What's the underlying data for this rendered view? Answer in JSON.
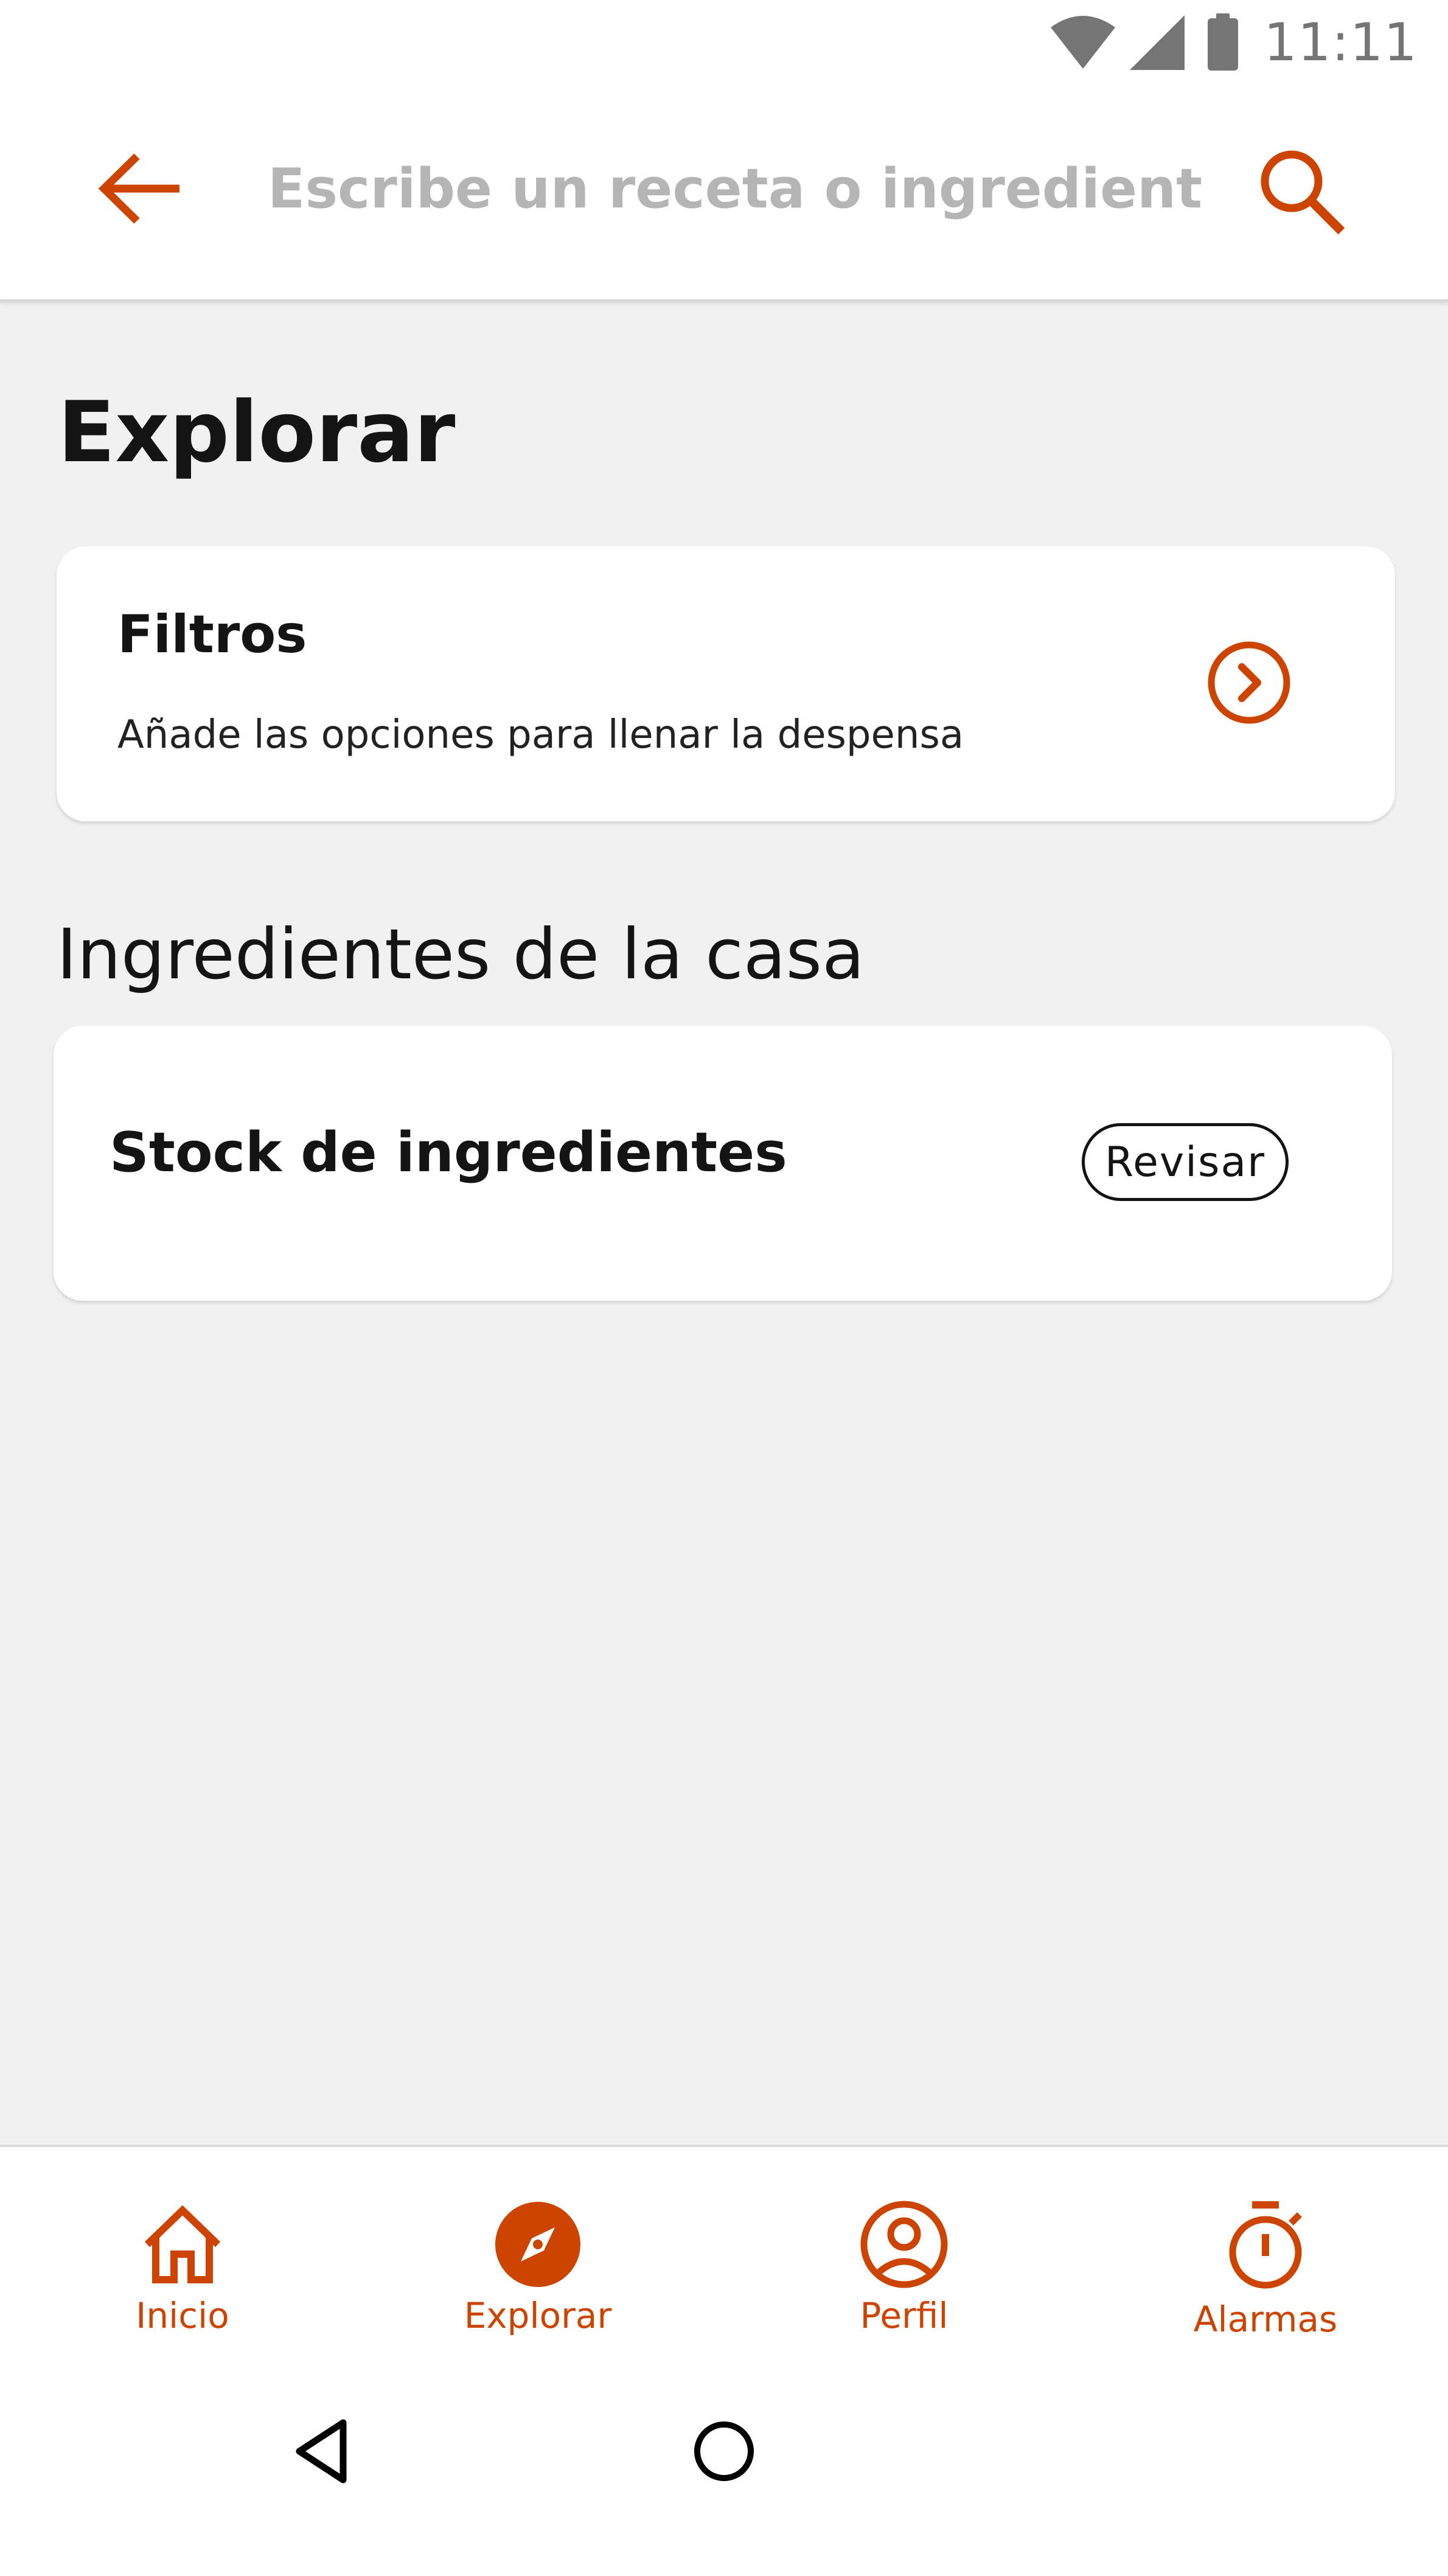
{
  "status_bar": {
    "time": "11:11",
    "icons": [
      "wifi-icon",
      "signal-icon",
      "battery-icon"
    ]
  },
  "search": {
    "placeholder": "Escribe un receta o ingrediente",
    "value": "",
    "icons": [
      "back-arrow-icon",
      "search-icon"
    ]
  },
  "main": {
    "title": "Explorar",
    "filters_card": {
      "title": "Filtros",
      "subtitle": "Añade las opciones para llenar la despensa",
      "icon": "chevron-right-circle-icon"
    },
    "section_title": "Ingredientes de la casa",
    "stock_card": {
      "title": "Stock de ingredientes",
      "button_label": "Revisar"
    }
  },
  "bottom_nav": {
    "items": [
      {
        "label": "Inicio",
        "icon": "home-icon"
      },
      {
        "label": "Explorar",
        "icon": "compass-icon",
        "active": true
      },
      {
        "label": "Perfil",
        "icon": "profile-icon"
      },
      {
        "label": "Alarmas",
        "icon": "timer-icon"
      }
    ]
  },
  "system_nav": {
    "icons": [
      "system-back-icon",
      "system-home-icon"
    ]
  },
  "colors": {
    "accent": "#CC4400",
    "background": "#F1F1F1",
    "card": "#FFFFFF",
    "text": "#141414",
    "placeholder": "#B5B5B5"
  }
}
